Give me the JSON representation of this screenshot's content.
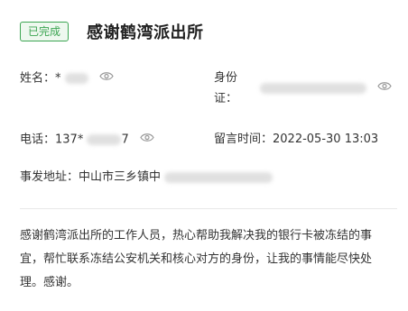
{
  "header": {
    "status_badge": "已完成",
    "title": "感谢鹤湾派出所"
  },
  "fields": {
    "name_label": "姓名：",
    "name_value": "*",
    "id_label_1": "身份",
    "id_label_2": "证：",
    "phone_label": "电话：",
    "phone_value": "137*",
    "phone_value_end": "7",
    "time_label": "留言时间：",
    "time_value": "2022-05-30 13:03",
    "address_label": "事发地址：",
    "address_value": "中山市三乡镇中"
  },
  "message": "感谢鹤湾派出所的工作人员，热心帮助我解决我的银行卡被冻结的事宜，帮忙联系冻结公安机关和核心对方的身份，让我的事情能尽快处理。感谢。",
  "colors": {
    "accent": "#3ca552",
    "text": "#333333",
    "divider": "#e8e8e8"
  },
  "icons": {
    "reveal": "eye-icon"
  }
}
